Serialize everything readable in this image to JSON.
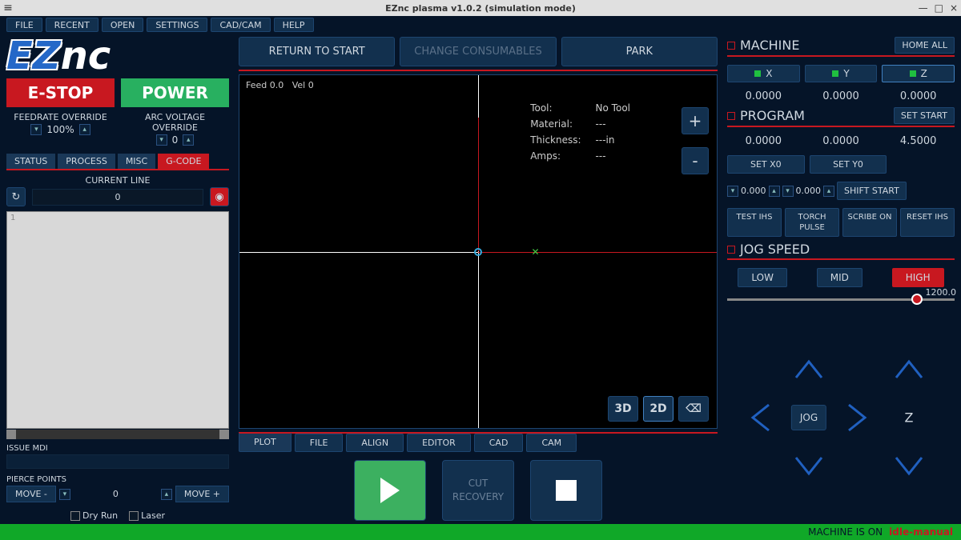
{
  "window": {
    "title": "EZnc plasma v1.0.2 (simulation mode)"
  },
  "menu": [
    "FILE",
    "RECENT",
    "OPEN",
    "SETTINGS",
    "CAD/CAM",
    "HELP"
  ],
  "logo": {
    "ez": "EZ",
    "nc": "nc"
  },
  "estop": "E-STOP",
  "power": "POWER",
  "override": {
    "feed": {
      "label": "FEEDRATE OVERRIDE",
      "value": "100%"
    },
    "arc": {
      "label": "ARC VOLTAGE OVERRIDE",
      "value": "0"
    }
  },
  "tabs": [
    "STATUS",
    "PROCESS",
    "MISC",
    "G-CODE"
  ],
  "active_tab": "G-CODE",
  "current_line": {
    "label": "CURRENT LINE",
    "value": "0"
  },
  "gcode_line1": "1",
  "mdi": {
    "label": "ISSUE MDI"
  },
  "pierce": {
    "label": "PIERCE POINTS",
    "move_minus": "MOVE -",
    "move_plus": "MOVE +",
    "value": "0"
  },
  "checks": {
    "dry": "Dry Run",
    "laser": "Laser"
  },
  "topbtns": {
    "return": "RETURN TO START",
    "change": "CHANGE CONSUMABLES",
    "park": "PARK"
  },
  "plot": {
    "feed": "Feed  0.0",
    "vel": "Vel  0",
    "tool_l": "Tool:",
    "tool_v": "No Tool",
    "mat_l": "Material:",
    "mat_v": "---",
    "thk_l": "Thickness:",
    "thk_v": "---in",
    "amp_l": "Amps:",
    "amp_v": "---"
  },
  "view": {
    "v3d": "3D",
    "v2d": "2D"
  },
  "ctabs": [
    "PLOT",
    "FILE",
    "ALIGN",
    "EDITOR",
    "CAD",
    "CAM"
  ],
  "cutrec": "CUT\nRECOVERY",
  "machine": {
    "title": "MACHINE",
    "home": "HOME ALL",
    "axes": [
      "X",
      "Y",
      "Z"
    ],
    "coords": [
      "0.0000",
      "0.0000",
      "0.0000"
    ]
  },
  "program": {
    "title": "PROGRAM",
    "setstart": "SET START",
    "coords": [
      "0.0000",
      "0.0000",
      "4.5000"
    ],
    "setx0": "SET X0",
    "sety0": "SET Y0",
    "spin1": "0.000",
    "spin2": "0.000",
    "shift": "SHIFT START",
    "fn": [
      "TEST IHS",
      "TORCH PULSE",
      "SCRIBE ON",
      "RESET IHS"
    ]
  },
  "jog": {
    "title": "JOG SPEED",
    "low": "LOW",
    "mid": "MID",
    "high": "HIGH",
    "speed": "1200.0",
    "ctr": "JOG",
    "z": "Z"
  },
  "status": {
    "on": "MACHINE IS ON",
    "mode": "idle-manual"
  }
}
